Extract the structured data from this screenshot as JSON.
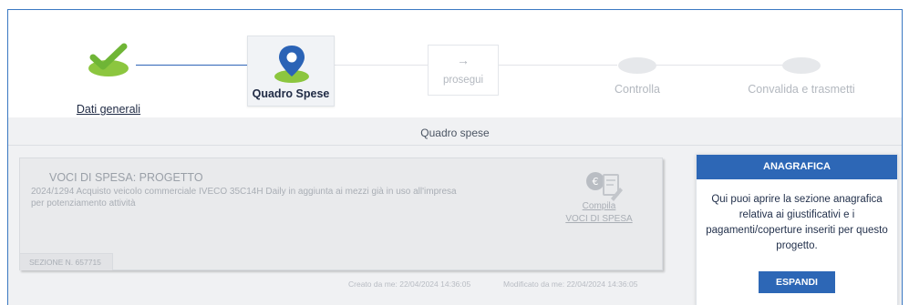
{
  "stepper": {
    "steps": [
      {
        "label": "Dati generali",
        "state": "done",
        "icon": "check-icon"
      },
      {
        "label": "Quadro Spese",
        "state": "active",
        "icon": "map-pin-icon"
      },
      {
        "label": "prosegui",
        "state": "next",
        "icon": "arrow-right-icon"
      },
      {
        "label": "Controlla",
        "state": "pending"
      },
      {
        "label": "Convalida e trasmetti",
        "state": "pending"
      }
    ],
    "arrow": "→"
  },
  "section": {
    "title": "Quadro spese"
  },
  "card": {
    "title": "VOCI DI SPESA: PROGETTO",
    "description": "2024/1294 Acquisto veicolo commerciale IVECO 35C14H Daily in aggiunta ai mezzi già in uso all'impresa per potenziamento attività",
    "link_line1": "Compila",
    "link_line2": "VOCI DI SPESA",
    "icon": "expense-document-icon",
    "section_number": "SEZIONE N. 657715",
    "created": "Creato da  me: 22/04/2024 14:36:05",
    "modified": "Modificato da  me: 22/04/2024 14:36:05"
  },
  "anagrafica": {
    "header": "ANAGRAFICA",
    "body": "Qui puoi aprire la sezione anagrafica relativa ai giustificativi e i pagamenti/coperture inseriti per questo progetto.",
    "button": "ESPANDI"
  },
  "colors": {
    "primary": "#2d67b6",
    "success": "#7cc242",
    "pin": "#2b63b6"
  }
}
